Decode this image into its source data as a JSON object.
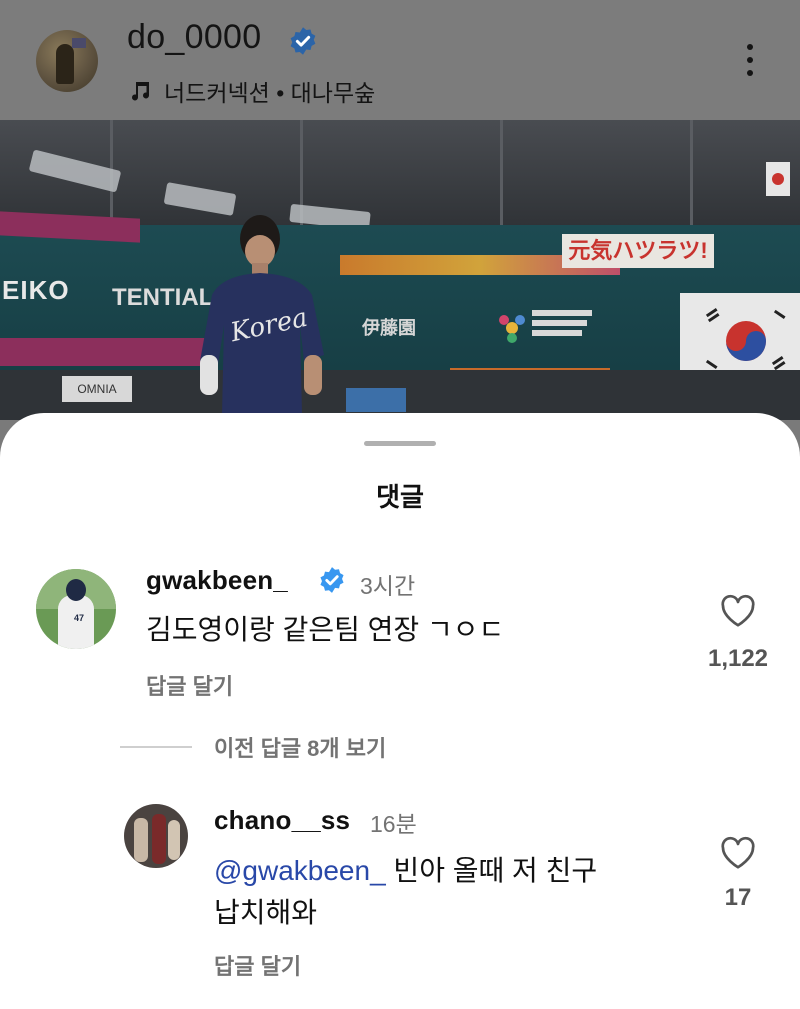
{
  "post": {
    "username": "do_0000",
    "music": "너드커넥션 • 대나무숲",
    "icons": [
      "verified-badge-icon",
      "music-note-icon",
      "more-options-icon"
    ]
  },
  "photo": {
    "signs": {
      "seiko": "EIKO",
      "tential": "TENTIAL",
      "ito": "伊藤園",
      "jp_banner": "元気ハツラツ!",
      "omnia": "OMNIA"
    },
    "jersey_text": "Korea"
  },
  "comments_sheet": {
    "title": "댓글",
    "comments": [
      {
        "username": "gwakbeen_",
        "verified": true,
        "time": "3시간",
        "text": "김도영이랑 같은팀 연장 ㄱㅇㄷ",
        "reply_label": "답글 달기",
        "likes": "1,122"
      }
    ],
    "view_previous": "이전 답글 8개 보기",
    "replies": [
      {
        "username": "chano__ss",
        "time": "16분",
        "mention": "@gwakbeen_",
        "text_line1": " 빈아 올때 저 친구",
        "text_line2": "납치해와",
        "reply_label": "답글 달기",
        "likes": "17"
      }
    ]
  },
  "colors": {
    "verified_blue": "#3897f0",
    "mention_blue": "#2948a8",
    "secondary_text": "#737373",
    "dim_overlay": "#7c7c7c"
  }
}
